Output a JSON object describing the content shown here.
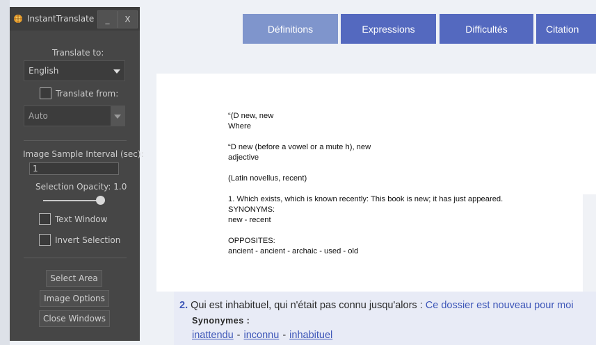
{
  "web": {
    "tabs": [
      {
        "label": "Définitions"
      },
      {
        "label": "Expressions"
      },
      {
        "label": "Difficultés"
      },
      {
        "label": "Citation"
      }
    ],
    "overlay_lines": [
      "“(D new, new",
      "Where",
      "",
      "“D new (before a vowel or a mute h), new",
      "adjective",
      "",
      "(Latin novellus, recent)",
      "",
      "1. Which exists, which is known recently: This book is new; it has just appeared.",
      "SYNONYMS:",
      "new - recent",
      "",
      "OPPOSITES:",
      "ancient - ancient - archaic - used - old"
    ],
    "definition": {
      "number": "2.",
      "text": "Qui est inhabituel, qui n'était pas connu jusqu'alors :",
      "example": "Ce dossier est nouveau pour moi",
      "synonyms_heading": "Synonymes :",
      "synonyms": [
        "inattendu",
        "inconnu",
        "inhabituel"
      ],
      "separator": "-"
    }
  },
  "panel": {
    "title": "InstantTranslate",
    "minimize_label": "_",
    "close_label": "X",
    "translate_to_label": "Translate to:",
    "translate_to_value": "English",
    "translate_from_label": "Translate from:",
    "translate_from_checked": false,
    "translate_from_value": "Auto",
    "interval_label": "Image Sample Interval (sec):",
    "interval_value": "1",
    "opacity_label": "Selection Opacity: 1.0",
    "opacity_value": 1.0,
    "text_window_label": "Text Window",
    "text_window_checked": false,
    "invert_selection_label": "Invert Selection",
    "invert_selection_checked": false,
    "select_area_label": "Select Area",
    "image_options_label": "Image Options",
    "close_windows_label": "Close Windows"
  },
  "colors": {
    "tab_active": "#7f95cc",
    "tab_inactive": "#5469bf",
    "link": "#3d56b8",
    "panel_bg": "#464646"
  }
}
